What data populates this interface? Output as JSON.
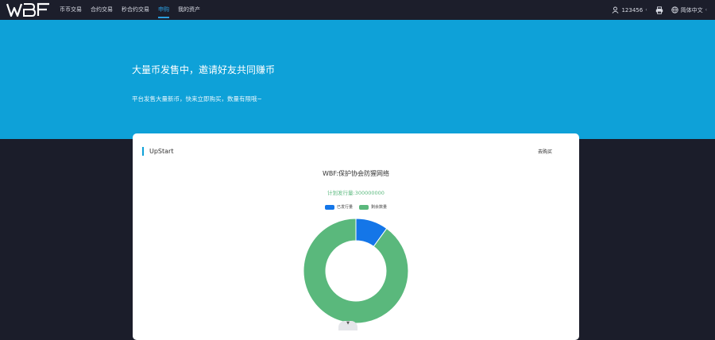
{
  "header": {
    "logo_text": "WBF",
    "nav": [
      {
        "label": "币币交易",
        "active": false
      },
      {
        "label": "合约交易",
        "active": false
      },
      {
        "label": "秒合约交易",
        "active": false
      },
      {
        "label": "申购",
        "active": true
      },
      {
        "label": "我的资产",
        "active": false
      }
    ],
    "user": {
      "label": "123456",
      "icon": "user-icon"
    },
    "print_icon": "printer-icon",
    "language": {
      "label": "简体中文",
      "icon": "globe-icon"
    }
  },
  "hero": {
    "title": "大量币发售中，邀请好友共同赚币",
    "subtitle": "平台发售大量新币，快来立即购买，数量有限哦~"
  },
  "card": {
    "name": "UpStart",
    "buy_label": "去购买",
    "project_name": "WBF:保护协会防猩网络",
    "plan_label": "计划发行量:300000000"
  },
  "chart_data": {
    "type": "pie",
    "series": [
      {
        "name": "已发行量",
        "value": 0.1,
        "color": "#1476e8"
      },
      {
        "name": "剩余数量",
        "value": 0.9,
        "color": "#5ab87c"
      }
    ],
    "donut": true,
    "legend": "top"
  },
  "colors": {
    "accent": "#0ea1d8",
    "active_nav": "#2a9fe0",
    "issued": "#1476e8",
    "remaining": "#5ab87c"
  }
}
